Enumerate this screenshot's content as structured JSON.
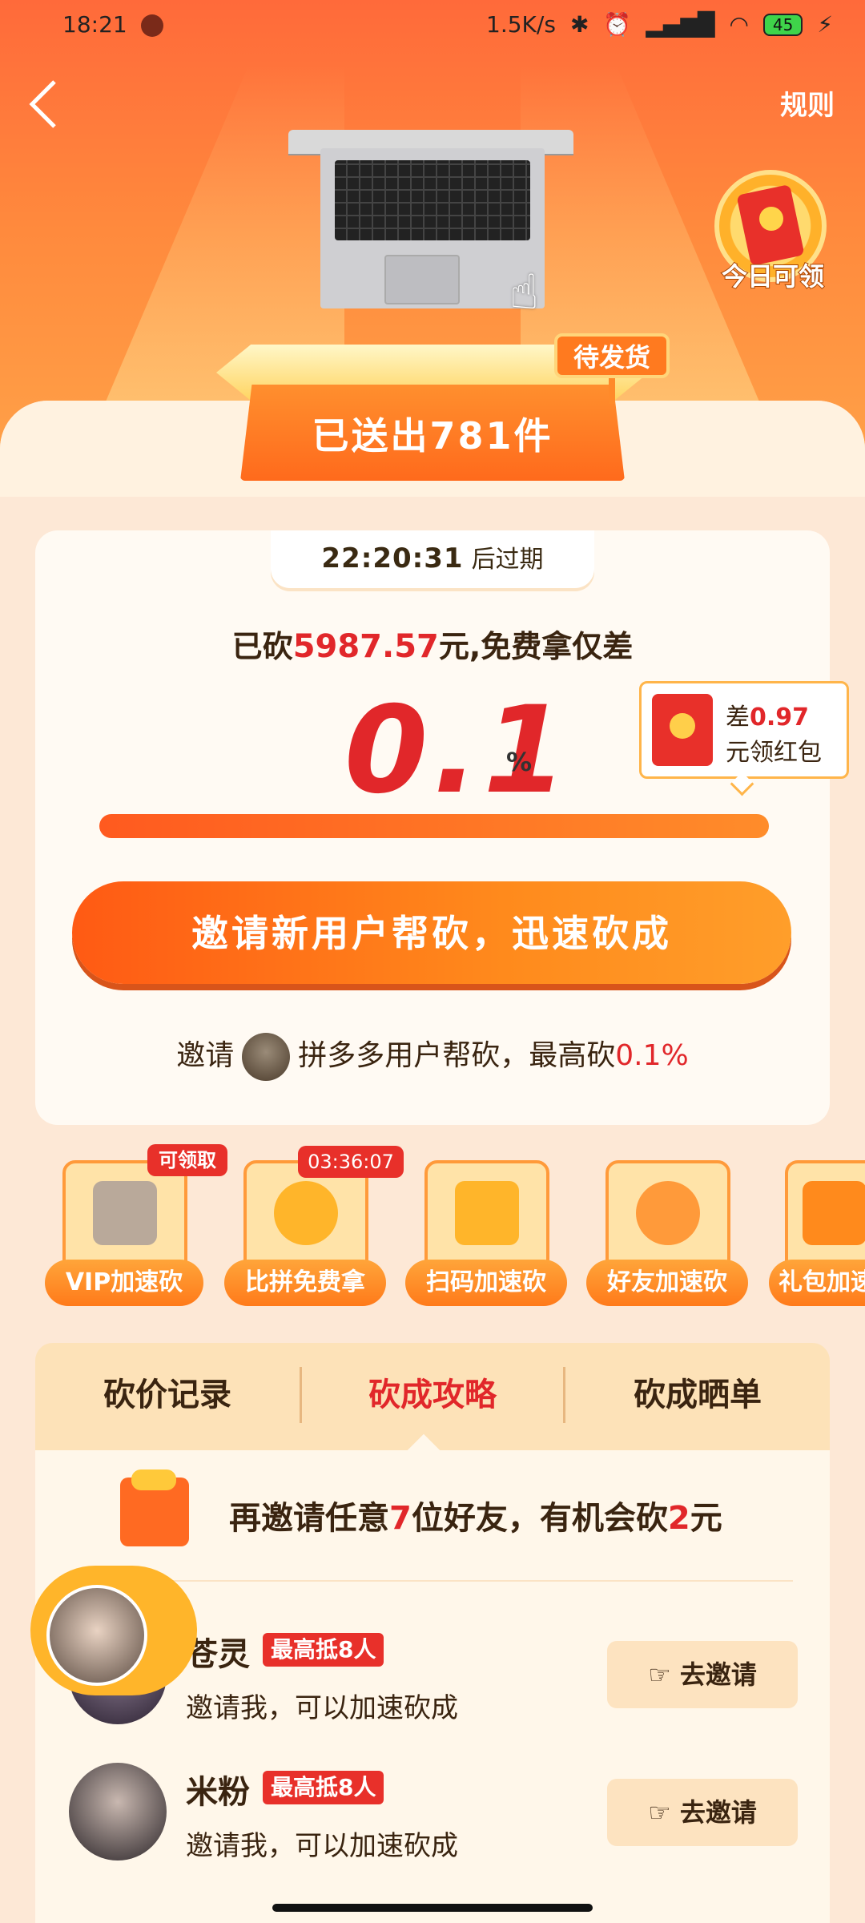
{
  "status_bar": {
    "time": "18:21",
    "network_speed": "1.5K/s",
    "battery": "45"
  },
  "header": {
    "rules_label": "规则"
  },
  "hero": {
    "sent_text": "已送出781件",
    "pending_label": "待发货",
    "daily_claim_label": "今日可领"
  },
  "card": {
    "timer_value": "22:20:31",
    "timer_suffix": "后过期",
    "cut_prefix": "已砍",
    "cut_amount": "5987.57",
    "cut_suffix": "元,免费拿仅差",
    "percent_value": "0.1",
    "percent_sign": "%",
    "progress_percent": 99.9,
    "bubble_prefix": "差",
    "bubble_amount": "0.97",
    "bubble_suffix": "元领红包",
    "cta_label": "邀请新用户帮砍，迅速砍成",
    "invite_prefix": "邀请",
    "invite_mid": "拼多多用户帮砍，最高砍",
    "invite_pct": "0.1%"
  },
  "tools": [
    {
      "label": "VIP加速砍",
      "tag": "可领取"
    },
    {
      "label": "比拼免费拿",
      "tag": "03:36:07"
    },
    {
      "label": "扫码加速砍"
    },
    {
      "label": "好友加速砍"
    },
    {
      "label": "礼包加速砍"
    }
  ],
  "tabs": [
    {
      "label": "砍价记录"
    },
    {
      "label": "砍成攻略"
    },
    {
      "label": "砍成晒单"
    }
  ],
  "strategy": {
    "text_prefix": "再邀请任意",
    "text_num": "7",
    "text_mid": "位好友，有机会砍",
    "text_num2": "2",
    "text_suffix": "元"
  },
  "friends": [
    {
      "name": "苍灵",
      "badge": "最高抵8人",
      "subtitle": "邀请我，可以加速砍成",
      "button": "去邀请"
    },
    {
      "name": "米粉",
      "badge": "最高抵8人",
      "subtitle": "邀请我，可以加速砍成",
      "button": "去邀请"
    }
  ],
  "colors": {
    "accent": "#ff6a1c",
    "highlight": "#e1272a",
    "text": "#3a2410"
  }
}
